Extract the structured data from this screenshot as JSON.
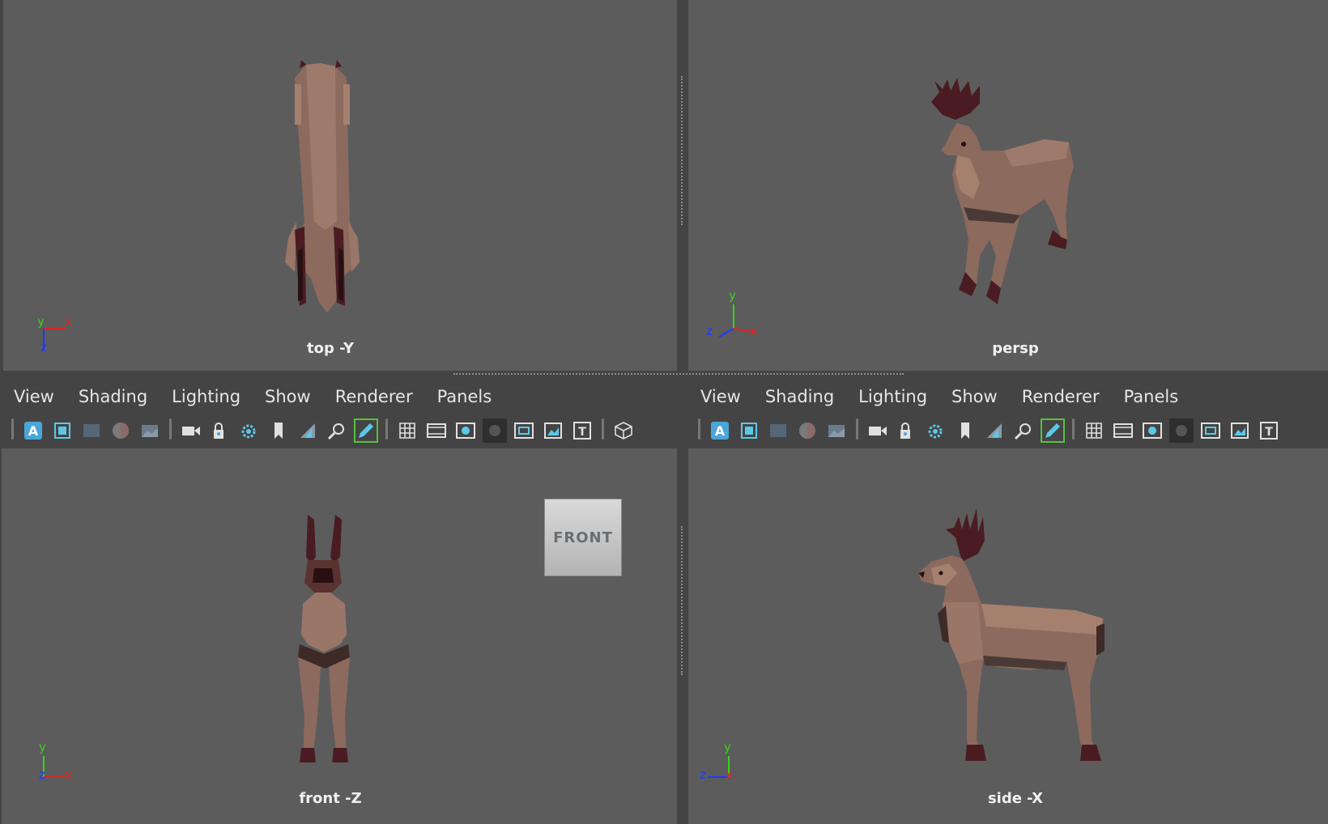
{
  "viewports": {
    "top": {
      "label": "top -Y"
    },
    "persp": {
      "label": "persp"
    },
    "front": {
      "label": "front -Z",
      "view_cube_label": "FRONT"
    },
    "side": {
      "label": "side -X"
    }
  },
  "menus": {
    "left": [
      "View",
      "Shading",
      "Lighting",
      "Show",
      "Renderer",
      "Panels"
    ],
    "right": [
      "View",
      "Shading",
      "Lighting",
      "Show",
      "Renderer",
      "Panels"
    ]
  },
  "axes": {
    "x": "x",
    "y": "y",
    "z": "z"
  },
  "colors": {
    "viewport_bg": "#5c5c5c",
    "ui_bg": "#444444",
    "axis_x": "#e0221f",
    "axis_y": "#3ad11c",
    "axis_z": "#1f39ff",
    "model_body": "#8c6a5e",
    "model_dark": "#4a1c22"
  },
  "toolbar_icons": [
    "select-camera-icon",
    "camera-attributes-icon",
    "bookmarks-icon",
    "image-plane-icon",
    "2d-pan-zoom-icon",
    "grease-pencil-icon",
    "grid-icon",
    "film-gate-icon",
    "resolution-gate-icon",
    "gate-mask-icon",
    "field-chart-icon",
    "safe-action-icon",
    "safe-title-icon"
  ]
}
